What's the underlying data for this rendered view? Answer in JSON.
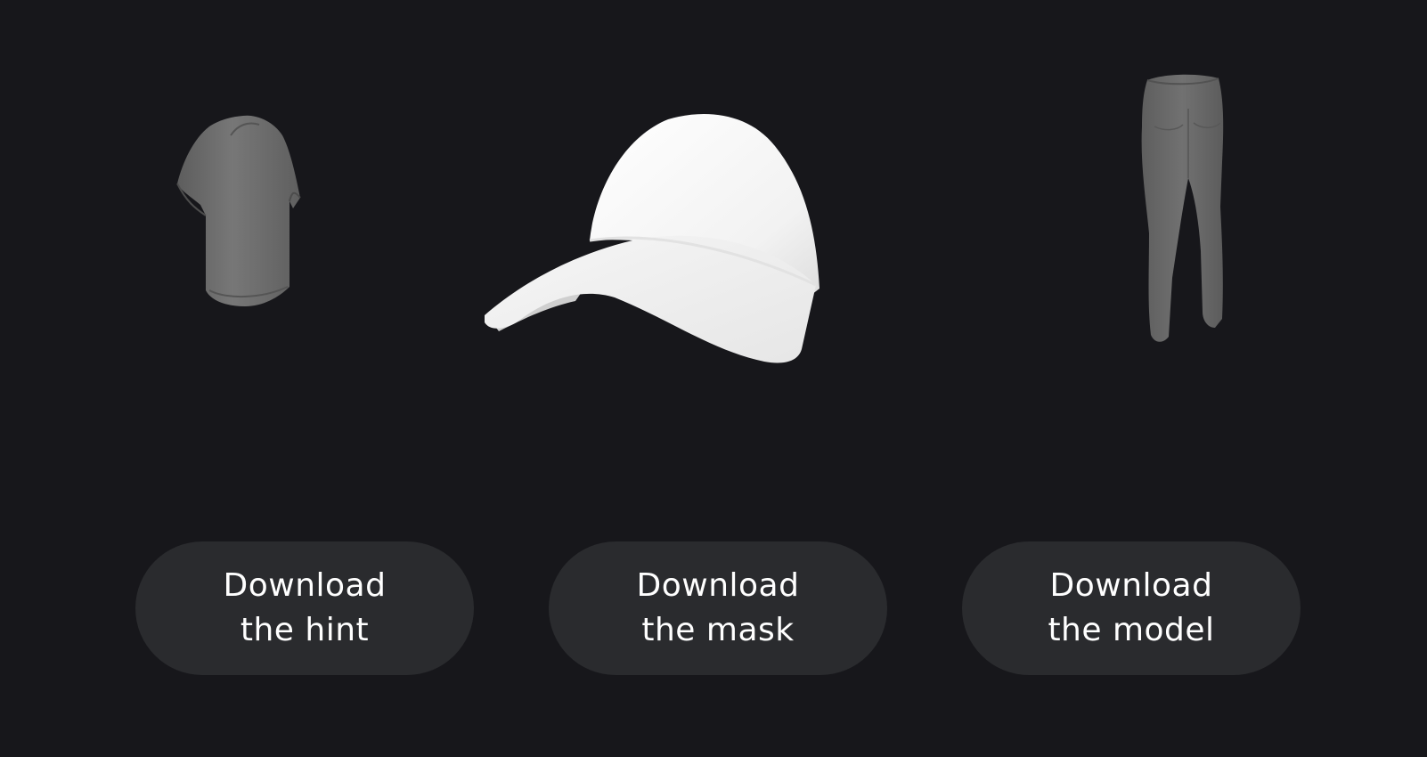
{
  "models": [
    {
      "name": "tshirt-model",
      "color": "#6f6f6f"
    },
    {
      "name": "cap-model",
      "color": "#f4f4f4"
    },
    {
      "name": "pants-model",
      "color": "#6b6b6b"
    }
  ],
  "buttons": {
    "hint": {
      "line1": "Download",
      "line2": "the hint"
    },
    "mask": {
      "line1": "Download",
      "line2": "the mask"
    },
    "model": {
      "line1": "Download",
      "line2": "the model"
    }
  },
  "colors": {
    "background": "#17171b",
    "button_bg": "#2a2b2e",
    "button_text": "#ffffff"
  }
}
